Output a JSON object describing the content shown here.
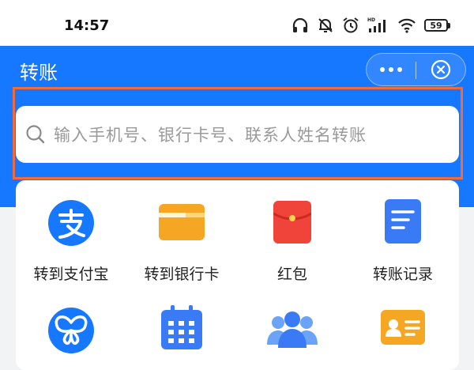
{
  "status_bar": {
    "time": "14:57",
    "battery": "59",
    "network_label": "HD"
  },
  "header": {
    "title": "转账"
  },
  "search": {
    "placeholder": "输入手机号、银行卡号、联系人姓名转账"
  },
  "grid": {
    "row1": [
      {
        "label": "转到支付宝",
        "icon": "alipay-icon"
      },
      {
        "label": "转到银行卡",
        "icon": "bank-card-icon"
      },
      {
        "label": "红包",
        "icon": "red-envelope-icon"
      },
      {
        "label": "转账记录",
        "icon": "transfer-record-icon"
      }
    ],
    "row2": [
      {
        "icon": "butterfly-icon"
      },
      {
        "icon": "calendar-icon"
      },
      {
        "icon": "contacts-icon"
      },
      {
        "icon": "id-card-icon"
      }
    ]
  },
  "colors": {
    "primary": "#1677ff",
    "highlight": "#f36b3b",
    "alipay": "#1677ff",
    "bank_card": "#f5a623",
    "red_envelope": "#f0443a",
    "record": "#3a7bf5"
  }
}
